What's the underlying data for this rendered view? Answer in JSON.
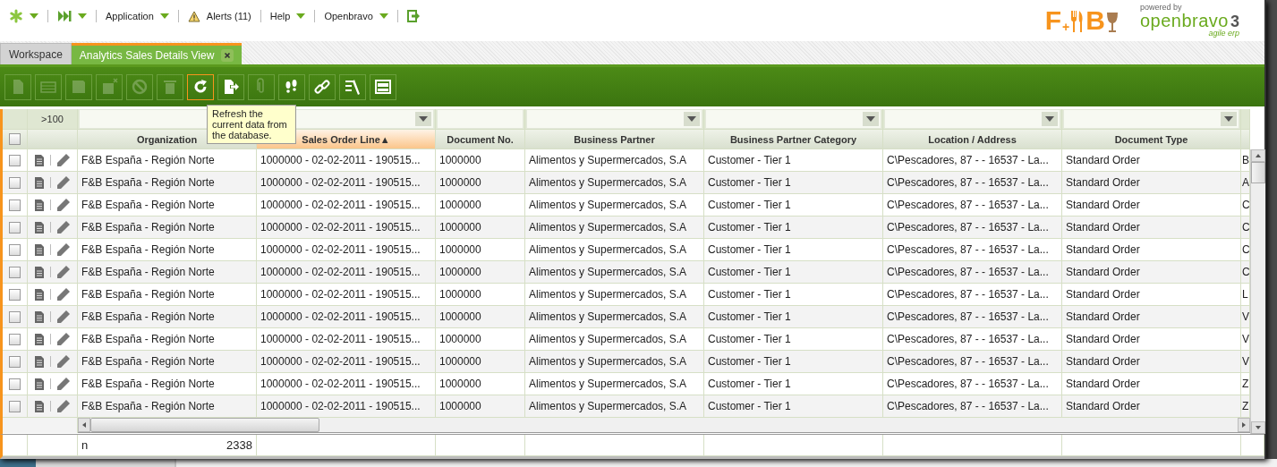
{
  "nav": [
    {
      "kind": "star"
    },
    {
      "kind": "forward"
    },
    {
      "kind": "menu",
      "label": "Application"
    },
    {
      "kind": "alert",
      "label": "Alerts (11)"
    },
    {
      "kind": "menu",
      "label": "Help"
    },
    {
      "kind": "menu",
      "label": "Openbravo"
    },
    {
      "kind": "logout"
    }
  ],
  "fb_logo": {
    "first": "F",
    "plus": "+",
    "second": "B"
  },
  "ob_logo": {
    "powered": "powered by",
    "name": "openbravo",
    "version": "3",
    "tagline": "agile erp"
  },
  "tabs": [
    {
      "label": "Workspace",
      "selected": false,
      "closable": false
    },
    {
      "label": "Analytics Sales Details View",
      "selected": true,
      "closable": true
    }
  ],
  "toolbar": [
    {
      "kind": "new-doc",
      "disabled": true,
      "highlighted": false
    },
    {
      "kind": "new-row",
      "disabled": true,
      "highlighted": false
    },
    {
      "kind": "save",
      "disabled": true,
      "highlighted": false
    },
    {
      "kind": "undo",
      "disabled": true,
      "highlighted": false
    },
    {
      "kind": "cancel",
      "disabled": true,
      "highlighted": false
    },
    {
      "kind": "delete",
      "disabled": true,
      "highlighted": false
    },
    {
      "kind": "refresh",
      "disabled": false,
      "highlighted": true
    },
    {
      "kind": "export",
      "disabled": false,
      "highlighted": false
    },
    {
      "kind": "attach",
      "disabled": true,
      "highlighted": false
    },
    {
      "kind": "audit",
      "disabled": false,
      "highlighted": false
    },
    {
      "kind": "link",
      "disabled": false,
      "highlighted": false
    },
    {
      "kind": "tools",
      "disabled": false,
      "highlighted": false
    },
    {
      "kind": "layout",
      "disabled": false,
      "highlighted": false
    }
  ],
  "tooltip": "Refresh the current data from the database.",
  "grid": {
    "row_count": ">100",
    "all_checked": false,
    "columns": [
      {
        "label": "Organization",
        "sorted": false
      },
      {
        "label": "Sales Order Line",
        "sorted": true,
        "sort_mark": "▲",
        "filter_dropdown": true
      },
      {
        "label": "Document No.",
        "sorted": false,
        "filter_dropdown": false
      },
      {
        "label": "Business Partner",
        "sorted": false,
        "filter_dropdown": true
      },
      {
        "label": "Business Partner Category",
        "sorted": false,
        "filter_dropdown": true
      },
      {
        "label": "Location / Address",
        "sorted": false,
        "filter_dropdown": true
      },
      {
        "label": "Document Type",
        "sorted": false,
        "filter_dropdown": true
      },
      {
        "sorted": false
      }
    ],
    "rows": [
      {
        "checked": false,
        "cells": [
          "F&B España - Región Norte",
          "1000000 - 02-02-2011 - 190515...",
          "1000000",
          "Alimentos y Supermercados, S.A",
          "Customer - Tier 1",
          "C\\Pescadores, 87 -  - 16537 - La...",
          "Standard Order",
          "B"
        ]
      },
      {
        "checked": false,
        "cells": [
          "F&B España - Región Norte",
          "1000000 - 02-02-2011 - 190515...",
          "1000000",
          "Alimentos y Supermercados, S.A",
          "Customer - Tier 1",
          "C\\Pescadores, 87 -  - 16537 - La...",
          "Standard Order",
          "A"
        ]
      },
      {
        "checked": false,
        "cells": [
          "F&B España - Región Norte",
          "1000000 - 02-02-2011 - 190515...",
          "1000000",
          "Alimentos y Supermercados, S.A",
          "Customer - Tier 1",
          "C\\Pescadores, 87 -  - 16537 - La...",
          "Standard Order",
          "C"
        ]
      },
      {
        "checked": false,
        "cells": [
          "F&B España - Región Norte",
          "1000000 - 02-02-2011 - 190515...",
          "1000000",
          "Alimentos y Supermercados, S.A",
          "Customer - Tier 1",
          "C\\Pescadores, 87 -  - 16537 - La...",
          "Standard Order",
          "C"
        ]
      },
      {
        "checked": false,
        "cells": [
          "F&B España - Región Norte",
          "1000000 - 02-02-2011 - 190515...",
          "1000000",
          "Alimentos y Supermercados, S.A",
          "Customer - Tier 1",
          "C\\Pescadores, 87 -  - 16537 - La...",
          "Standard Order",
          "C"
        ]
      },
      {
        "checked": false,
        "cells": [
          "F&B España - Región Norte",
          "1000000 - 02-02-2011 - 190515...",
          "1000000",
          "Alimentos y Supermercados, S.A",
          "Customer - Tier 1",
          "C\\Pescadores, 87 -  - 16537 - La...",
          "Standard Order",
          "C"
        ]
      },
      {
        "checked": false,
        "cells": [
          "F&B España - Región Norte",
          "1000000 - 02-02-2011 - 190515...",
          "1000000",
          "Alimentos y Supermercados, S.A",
          "Customer - Tier 1",
          "C\\Pescadores, 87 -  - 16537 - La...",
          "Standard Order",
          "L"
        ]
      },
      {
        "checked": false,
        "cells": [
          "F&B España - Región Norte",
          "1000000 - 02-02-2011 - 190515...",
          "1000000",
          "Alimentos y Supermercados, S.A",
          "Customer - Tier 1",
          "C\\Pescadores, 87 -  - 16537 - La...",
          "Standard Order",
          "V"
        ]
      },
      {
        "checked": false,
        "cells": [
          "F&B España - Región Norte",
          "1000000 - 02-02-2011 - 190515...",
          "1000000",
          "Alimentos y Supermercados, S.A",
          "Customer - Tier 1",
          "C\\Pescadores, 87 -  - 16537 - La...",
          "Standard Order",
          "V"
        ]
      },
      {
        "checked": false,
        "cells": [
          "F&B España - Región Norte",
          "1000000 - 02-02-2011 - 190515...",
          "1000000",
          "Alimentos y Supermercados, S.A",
          "Customer - Tier 1",
          "C\\Pescadores, 87 -  - 16537 - La...",
          "Standard Order",
          "V"
        ]
      },
      {
        "checked": false,
        "cells": [
          "F&B España - Región Norte",
          "1000000 - 02-02-2011 - 190515...",
          "1000000",
          "Alimentos y Supermercados, S.A",
          "Customer - Tier 1",
          "C\\Pescadores, 87 -  - 16537 - La...",
          "Standard Order",
          "Z"
        ]
      },
      {
        "checked": false,
        "cells": [
          "F&B España - Región Norte",
          "1000000 - 02-02-2011 - 190515...",
          "1000000",
          "Alimentos y Supermercados, S.A",
          "Customer - Tier 1",
          "C\\Pescadores, 87 -  - 16537 - La...",
          "Standard Order",
          "Z"
        ]
      }
    ],
    "summary": {
      "label": "n",
      "value": "2338"
    }
  }
}
